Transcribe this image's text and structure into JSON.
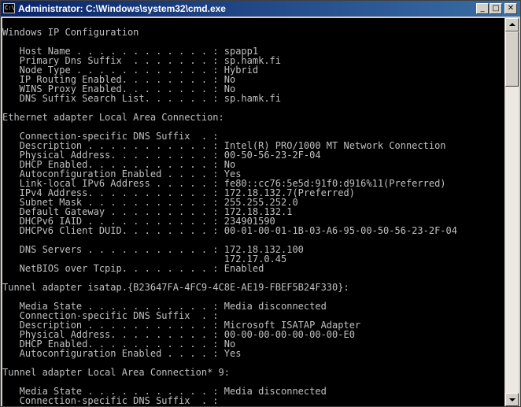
{
  "window": {
    "title": "Administrator: C:\\Windows\\system32\\cmd.exe",
    "app_icon_glyph": "C:\\",
    "minimize_glyph": "_",
    "maximize_glyph": "□",
    "close_glyph": "✕"
  },
  "console": {
    "lines": [
      "",
      "Windows IP Configuration",
      "",
      "   Host Name . . . . . . . . . . . . : spapp1",
      "   Primary Dns Suffix  . . . . . . . : sp.hamk.fi",
      "   Node Type . . . . . . . . . . . . : Hybrid",
      "   IP Routing Enabled. . . . . . . . : No",
      "   WINS Proxy Enabled. . . . . . . . : No",
      "   DNS Suffix Search List. . . . . . : sp.hamk.fi",
      "",
      "Ethernet adapter Local Area Connection:",
      "",
      "   Connection-specific DNS Suffix  . :",
      "   Description . . . . . . . . . . . : Intel(R) PRO/1000 MT Network Connection",
      "   Physical Address. . . . . . . . . : 00-50-56-23-2F-04",
      "   DHCP Enabled. . . . . . . . . . . : No",
      "   Autoconfiguration Enabled . . . . : Yes",
      "   Link-local IPv6 Address . . . . . : fe80::cc76:5e5d:91f0:d916%11(Preferred)",
      "   IPv4 Address. . . . . . . . . . . : 172.18.132.7(Preferred)",
      "   Subnet Mask . . . . . . . . . . . : 255.255.252.0",
      "   Default Gateway . . . . . . . . . : 172.18.132.1",
      "   DHCPv6 IAID . . . . . . . . . . . : 234901590",
      "   DHCPv6 Client DUID. . . . . . . . : 00-01-00-01-1B-03-A6-95-00-50-56-23-2F-04",
      "",
      "   DNS Servers . . . . . . . . . . . : 172.18.132.100",
      "                                       172.17.0.45",
      "   NetBIOS over Tcpip. . . . . . . . : Enabled",
      "",
      "Tunnel adapter isatap.{B23647FA-4FC9-4C8E-AE19-FBEF5B24F330}:",
      "",
      "   Media State . . . . . . . . . . . : Media disconnected",
      "   Connection-specific DNS Suffix  . :",
      "   Description . . . . . . . . . . . : Microsoft ISATAP Adapter",
      "   Physical Address. . . . . . . . . : 00-00-00-00-00-00-00-E0",
      "   DHCP Enabled. . . . . . . . . . . : No",
      "   Autoconfiguration Enabled . . . . : Yes",
      "",
      "Tunnel adapter Local Area Connection* 9:",
      "",
      "   Media State . . . . . . . . . . . : Media disconnected",
      "   Connection-specific DNS Suffix  . :"
    ]
  }
}
